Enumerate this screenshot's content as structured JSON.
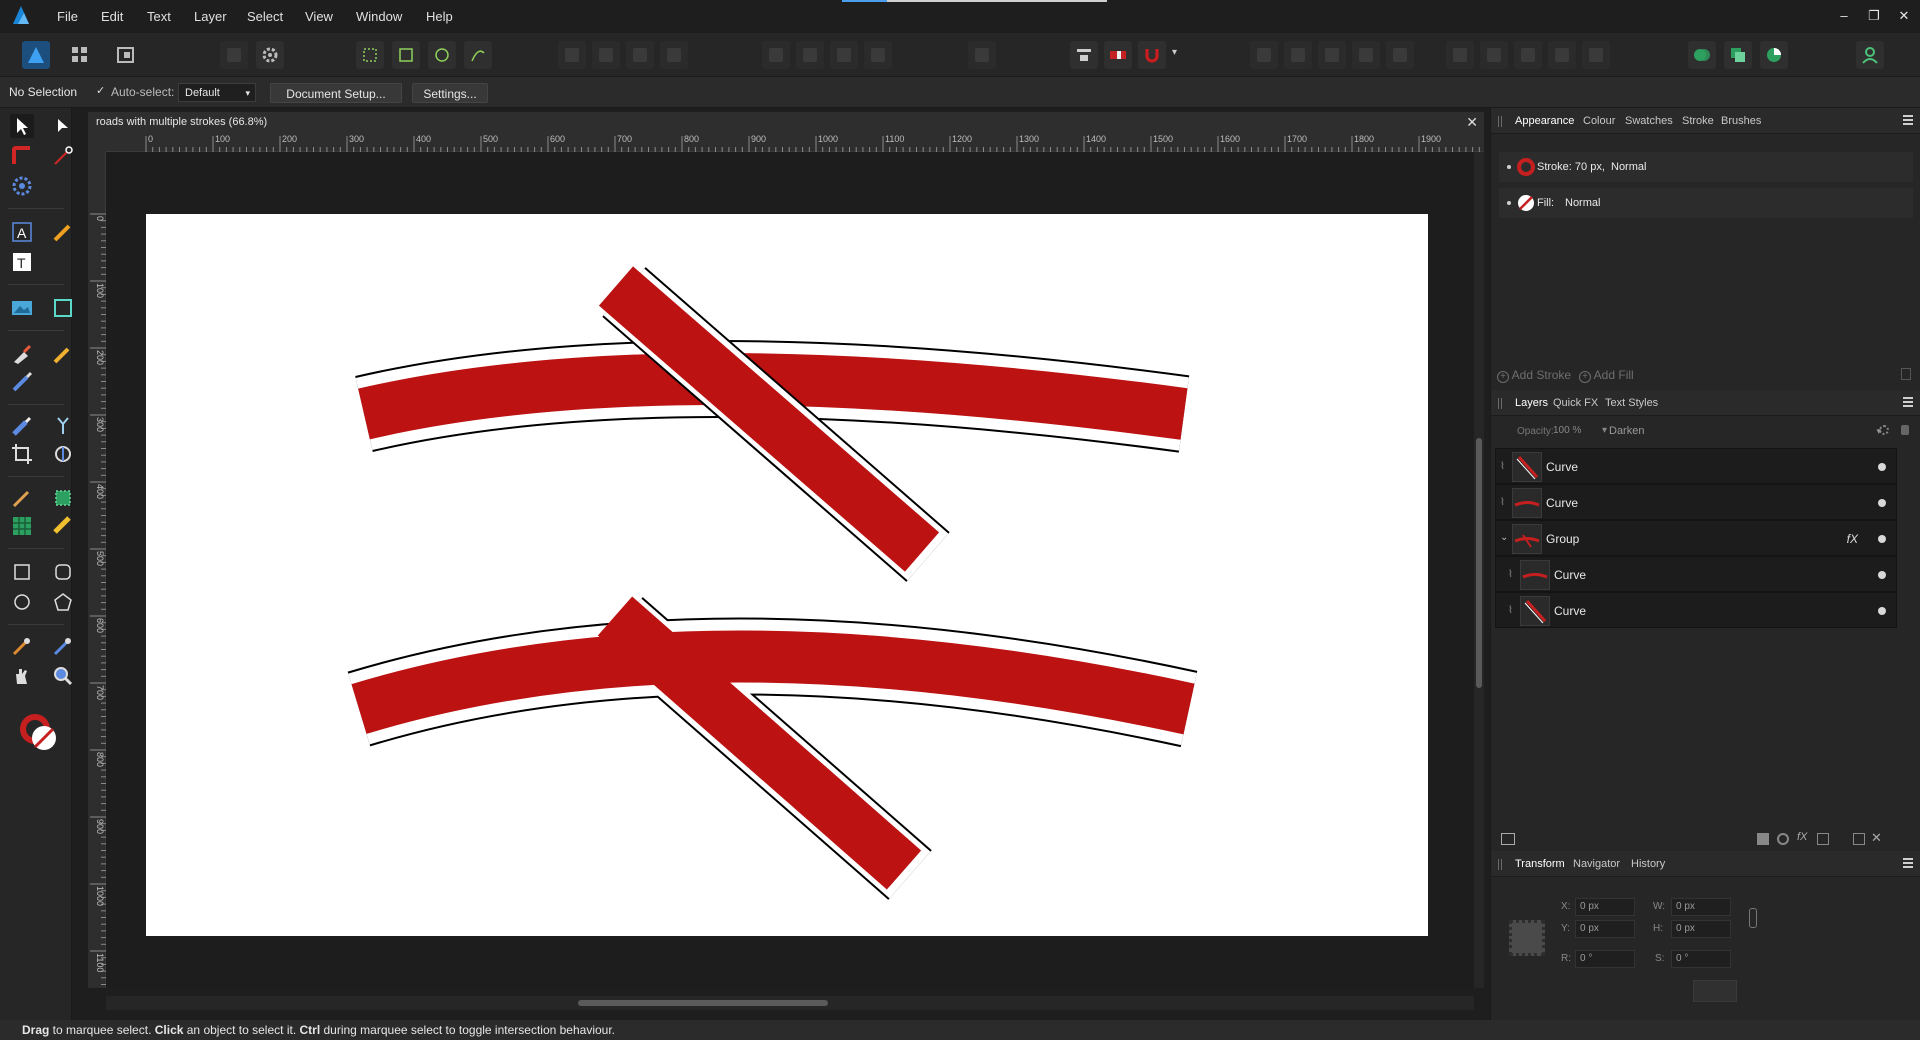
{
  "menu": [
    "File",
    "Edit",
    "Text",
    "Layer",
    "Select",
    "View",
    "Window",
    "Help"
  ],
  "window_controls": {
    "minimize": "–",
    "restore": "❐",
    "close": "✕"
  },
  "context": {
    "selection_label": "No Selection",
    "autoselect_label": "Auto-select:",
    "autoselect_value": "Default",
    "document_setup": "Document Setup...",
    "settings": "Settings..."
  },
  "document": {
    "title": "roads with multiple strokes (66.8%)",
    "close": "✕",
    "ruler_h": [
      "0",
      "100",
      "200",
      "300",
      "400",
      "500",
      "600",
      "700",
      "800",
      "900",
      "1000",
      "1100",
      "1200",
      "1300",
      "1400",
      "1500",
      "1600",
      "1700",
      "1800",
      "1900"
    ],
    "ruler_v": [
      "0",
      "100",
      "200",
      "300",
      "400",
      "500",
      "600",
      "700",
      "800",
      "900",
      "1000",
      "1100"
    ]
  },
  "appearance": {
    "tabs": [
      "Appearance",
      "Colour",
      "Swatches",
      "Stroke",
      "Brushes"
    ],
    "stroke_label": "Stroke: 70 px,",
    "stroke_mode": "Normal",
    "fill_label": "Fill:",
    "fill_mode": "Normal",
    "add_stroke": "Add Stroke",
    "add_fill": "Add Fill"
  },
  "layers": {
    "tabs": [
      "Layers",
      "Quick FX",
      "Text Styles"
    ],
    "opacity_label": "Opacity:",
    "opacity_value": "100 %",
    "blend_mode": "Darken",
    "items": [
      {
        "name": "Curve",
        "thumb": "diag"
      },
      {
        "name": "Curve",
        "thumb": "arc"
      },
      {
        "name": "Group",
        "thumb": "group",
        "fx": "fX"
      },
      {
        "name": "Curve",
        "thumb": "arc"
      },
      {
        "name": "Curve",
        "thumb": "diag"
      }
    ]
  },
  "transform": {
    "tabs": [
      "Transform",
      "Navigator",
      "History"
    ],
    "x_label": "X:",
    "x_value": "0 px",
    "y_label": "Y:",
    "y_value": "0 px",
    "w_label": "W:",
    "w_value": "0 px",
    "h_label": "H:",
    "h_value": "0 px",
    "r_label": "R:",
    "r_value": "0 °",
    "s_label": "S:",
    "s_value": "0 °"
  },
  "status": {
    "drag": "Drag",
    "t1": " to marquee select. ",
    "click": "Click",
    "t2": " an object to select it. ",
    "ctrl": "Ctrl",
    "t3": " during marquee select to toggle intersection behaviour."
  },
  "colors": {
    "accent": "#4a9eea",
    "road": "#bc1212",
    "background": "#1e1e1e"
  }
}
